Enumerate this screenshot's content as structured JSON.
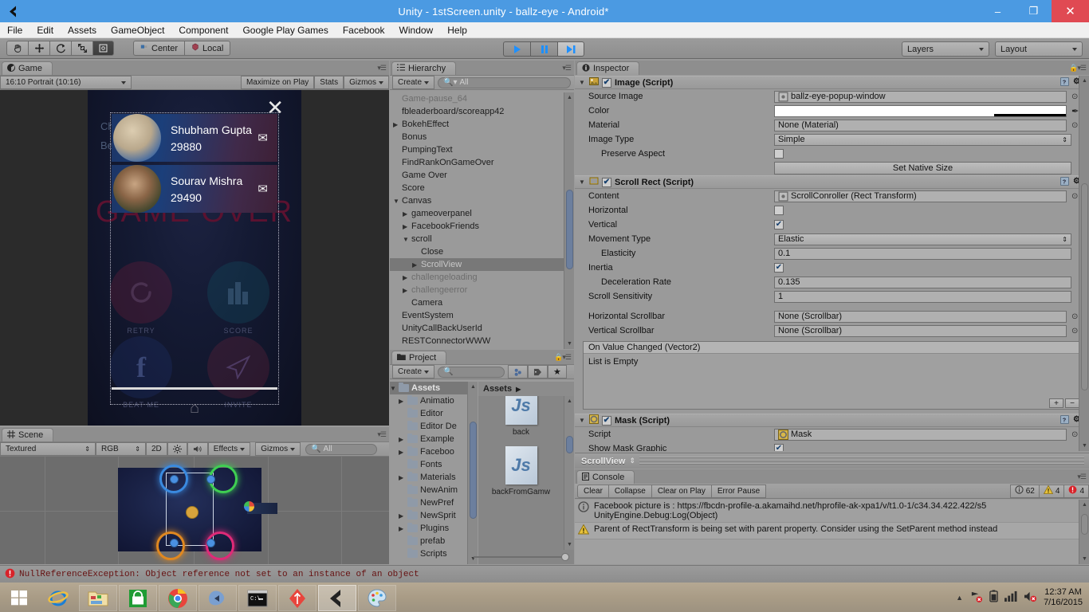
{
  "window": {
    "title": "Unity - 1stScreen.unity - ballz-eye - Android*",
    "minimize": "–",
    "maximize": "❐",
    "close": "✕"
  },
  "menubar": {
    "items": [
      "File",
      "Edit",
      "Assets",
      "GameObject",
      "Component",
      "Google Play Games",
      "Facebook",
      "Window",
      "Help"
    ]
  },
  "toolbar": {
    "tools": [
      "hand-tool",
      "move-tool",
      "rotate-tool",
      "scale-tool",
      "rect-tool"
    ],
    "pivot_mode": "Center",
    "pivot_space": "Local",
    "play": "▶",
    "pause": "❚❚",
    "step": "▶❙",
    "layers": "Layers",
    "layout": "Layout"
  },
  "game_view": {
    "tab": "Game",
    "aspect": "16:10 Portrait (10:16)",
    "maximize_on_play": "Maximize on Play",
    "stats": "Stats",
    "gizmos": "Gizmos",
    "close_label": "✕",
    "gameover_text": "GAME OVER",
    "challenge_line1": "Ch",
    "challenge_line2": "Be",
    "friends": [
      {
        "name": "Shubham Gupta",
        "score": "29880",
        "mail_icon": "envelope-icon"
      },
      {
        "name": "Sourav Mishra",
        "score": "29490",
        "mail_icon": "envelope-icon"
      }
    ],
    "grid_buttons": [
      {
        "label": "RETRY",
        "icon": "refresh-icon"
      },
      {
        "label": "SCORE",
        "icon": "bar-chart-icon"
      },
      {
        "label": "BEAT ME",
        "icon": "facebook-icon"
      },
      {
        "label": "INVITE",
        "icon": "paper-plane-icon"
      }
    ],
    "home_icon": "home-icon"
  },
  "scene_view": {
    "tab": "Scene",
    "draw_mode": "Textured",
    "color_mode": "RGB",
    "two_d": "2D",
    "lighting_icon": "sun-icon",
    "audio_icon": "speaker-icon",
    "effects": "Effects",
    "gizmos": "Gizmos",
    "search_placeholder": "All"
  },
  "hierarchy": {
    "tab": "Hierarchy",
    "create": "Create",
    "search_placeholder": "All",
    "items": [
      {
        "label": "Game-pause_64",
        "depth": 0,
        "arrow": "none",
        "state": "dim"
      },
      {
        "label": "fbleaderboard/scoreapp42",
        "depth": 0,
        "arrow": "none",
        "state": "normal"
      },
      {
        "label": "BokehEffect",
        "depth": 0,
        "arrow": "closed",
        "state": "normal"
      },
      {
        "label": "Bonus",
        "depth": 0,
        "arrow": "none",
        "state": "normal"
      },
      {
        "label": "PumpingText",
        "depth": 0,
        "arrow": "none",
        "state": "normal"
      },
      {
        "label": "FindRankOnGameOver",
        "depth": 0,
        "arrow": "none",
        "state": "normal"
      },
      {
        "label": "Game Over",
        "depth": 0,
        "arrow": "none",
        "state": "normal"
      },
      {
        "label": "Score",
        "depth": 0,
        "arrow": "none",
        "state": "normal"
      },
      {
        "label": "Canvas",
        "depth": 0,
        "arrow": "open",
        "state": "normal"
      },
      {
        "label": "gameoverpanel",
        "depth": 1,
        "arrow": "closed",
        "state": "normal"
      },
      {
        "label": "FacebookFriends",
        "depth": 1,
        "arrow": "closed",
        "state": "normal"
      },
      {
        "label": "scroll",
        "depth": 1,
        "arrow": "open",
        "state": "normal"
      },
      {
        "label": "Close",
        "depth": 2,
        "arrow": "none",
        "state": "normal"
      },
      {
        "label": "ScrollView",
        "depth": 2,
        "arrow": "closed",
        "state": "selected"
      },
      {
        "label": "challengeloading",
        "depth": 1,
        "arrow": "closed",
        "state": "dim"
      },
      {
        "label": "challengeerror",
        "depth": 1,
        "arrow": "closed",
        "state": "dim"
      },
      {
        "label": "Camera",
        "depth": 1,
        "arrow": "none",
        "state": "normal"
      },
      {
        "label": "EventSystem",
        "depth": 0,
        "arrow": "none",
        "state": "normal"
      },
      {
        "label": "UnityCallBackUserId",
        "depth": 0,
        "arrow": "none",
        "state": "normal"
      },
      {
        "label": "RESTConnectorWWW",
        "depth": 0,
        "arrow": "none",
        "state": "normal"
      }
    ]
  },
  "project": {
    "tab": "Project",
    "create": "Create",
    "search_placeholder": "",
    "breadcrumb": "Assets",
    "tree": [
      {
        "label": "Assets",
        "depth": 0,
        "arrow": "open",
        "state": "selected"
      },
      {
        "label": "Animatio",
        "depth": 1,
        "arrow": "closed",
        "state": "normal"
      },
      {
        "label": "Editor",
        "depth": 1,
        "arrow": "none",
        "state": "normal"
      },
      {
        "label": "Editor De",
        "depth": 1,
        "arrow": "none",
        "state": "normal"
      },
      {
        "label": "Example",
        "depth": 1,
        "arrow": "closed",
        "state": "normal"
      },
      {
        "label": "Faceboo",
        "depth": 1,
        "arrow": "closed",
        "state": "normal"
      },
      {
        "label": "Fonts",
        "depth": 1,
        "arrow": "none",
        "state": "normal"
      },
      {
        "label": "Materials",
        "depth": 1,
        "arrow": "closed",
        "state": "normal"
      },
      {
        "label": "NewAnim",
        "depth": 1,
        "arrow": "none",
        "state": "normal"
      },
      {
        "label": "NewPref",
        "depth": 1,
        "arrow": "none",
        "state": "normal"
      },
      {
        "label": "NewSprit",
        "depth": 1,
        "arrow": "closed",
        "state": "normal"
      },
      {
        "label": "Plugins",
        "depth": 1,
        "arrow": "closed",
        "state": "normal"
      },
      {
        "label": "prefab",
        "depth": 1,
        "arrow": "none",
        "state": "normal"
      },
      {
        "label": "Scripts",
        "depth": 1,
        "arrow": "none",
        "state": "normal"
      }
    ],
    "assets": [
      {
        "label": "back",
        "type": "Js"
      },
      {
        "label": "backFromGamw",
        "type": "Js"
      }
    ]
  },
  "inspector": {
    "tab": "Inspector",
    "lock_icon": "lock-icon",
    "components": [
      {
        "name": "Image (Script)",
        "icon": "image-icon",
        "enabled": true,
        "properties": [
          {
            "label": "Source Image",
            "type": "objectref",
            "value": "ballz-eye-popup-window",
            "indent": 0
          },
          {
            "label": "Color",
            "type": "color",
            "value": "#FFFFFF",
            "indent": 0
          },
          {
            "label": "Material",
            "type": "objectref",
            "value": "None (Material)",
            "indent": 0
          },
          {
            "label": "Image Type",
            "type": "enum",
            "value": "Simple",
            "indent": 0
          },
          {
            "label": "Preserve Aspect",
            "type": "bool",
            "value": false,
            "indent": 1
          }
        ],
        "button": "Set Native Size"
      },
      {
        "name": "Scroll Rect (Script)",
        "icon": "scrollrect-icon",
        "enabled": true,
        "properties": [
          {
            "label": "Content",
            "type": "objectref",
            "value": "ScrollConroller (Rect Transform)",
            "indent": 0
          },
          {
            "label": "Horizontal",
            "type": "bool",
            "value": false,
            "indent": 0
          },
          {
            "label": "Vertical",
            "type": "bool",
            "value": true,
            "indent": 0
          },
          {
            "label": "Movement Type",
            "type": "enum",
            "value": "Elastic",
            "indent": 0
          },
          {
            "label": "Elasticity",
            "type": "text",
            "value": "0.1",
            "indent": 1
          },
          {
            "label": "Inertia",
            "type": "bool",
            "value": true,
            "indent": 0
          },
          {
            "label": "Deceleration Rate",
            "type": "text",
            "value": "0.135",
            "indent": 1
          },
          {
            "label": "Scroll Sensitivity",
            "type": "text",
            "value": "1",
            "indent": 0
          },
          {
            "label": "",
            "type": "spacer",
            "value": "",
            "indent": 0
          },
          {
            "label": "Horizontal Scrollbar",
            "type": "objectref",
            "value": "None (Scrollbar)",
            "indent": 0
          },
          {
            "label": "Vertical Scrollbar",
            "type": "objectref",
            "value": "None (Scrollbar)",
            "indent": 0
          }
        ],
        "event_list": {
          "header": "On Value Changed (Vector2)",
          "body": "List is Empty",
          "add": "+",
          "remove": "−"
        }
      },
      {
        "name": "Mask (Script)",
        "icon": "mask-icon",
        "enabled": true,
        "properties": [
          {
            "label": "Script",
            "type": "objectref",
            "value": "Mask",
            "indent": 0
          },
          {
            "label": "Show Mask Graphic",
            "type": "bool",
            "value": true,
            "indent": 0
          }
        ]
      }
    ],
    "footer_object": "ScrollView"
  },
  "console": {
    "tab": "Console",
    "buttons": [
      "Clear",
      "Collapse",
      "Clear on Play",
      "Error Pause"
    ],
    "counts": {
      "info": "62",
      "warning": "4",
      "error": "4"
    },
    "entries": [
      {
        "icon": "info-icon",
        "message": "Facebook picture is : https://fbcdn-profile-a.akamaihd.net/hprofile-ak-xpa1/v/t1.0-1/c34.34.422.422/s5",
        "sub": "UnityEngine.Debug:Log(Object)"
      },
      {
        "icon": "warning-icon",
        "message": "Parent of RectTransform is being set with parent property. Consider using the SetParent method instead",
        "sub": ""
      }
    ]
  },
  "status_bar": {
    "icon": "error-icon",
    "message": "NullReferenceException: Object reference not set to an instance of an object"
  },
  "taskbar": {
    "start": "windows-logo",
    "items": [
      {
        "name": "internet-explorer-icon",
        "active": false
      },
      {
        "name": "file-explorer-icon",
        "active": false
      },
      {
        "name": "windows-store-icon",
        "active": false
      },
      {
        "name": "chrome-icon",
        "active": false
      },
      {
        "name": "monodevelop-icon",
        "active": false
      },
      {
        "name": "command-prompt-icon",
        "active": false
      },
      {
        "name": "sourcetree-icon",
        "active": false
      },
      {
        "name": "unity-icon",
        "active": true
      },
      {
        "name": "paint-icon",
        "active": false
      }
    ],
    "tray": [
      "show-hidden-icons",
      "network-icon",
      "battery-icon",
      "signal-icon",
      "volume-icon"
    ],
    "time": "12:37 AM",
    "date": "7/16/2015"
  }
}
